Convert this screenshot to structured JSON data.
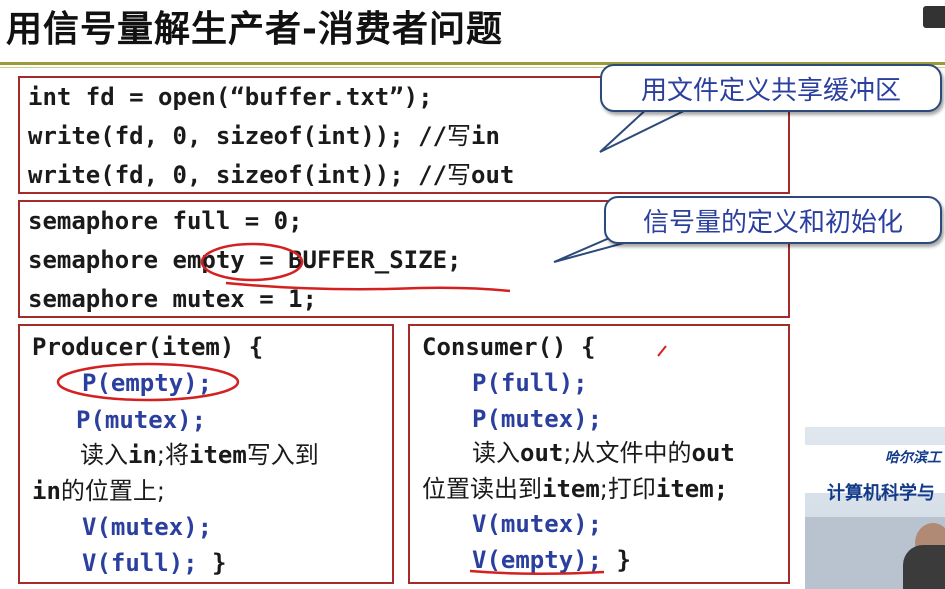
{
  "title": "用信号量解生产者-消费者问题",
  "buffer_block": {
    "lines": [
      "int fd = open(“buffer.txt”);",
      "write(fd, 0, sizeof(int)); //",
      "write(fd, 0, sizeof(int)); //"
    ],
    "line2_cn": "写",
    "line2_tail": "in",
    "line3_cn": "写",
    "line3_tail": "out",
    "callout": "用文件定义共享缓冲区"
  },
  "semaphore_block": {
    "lines": [
      "semaphore full = 0;",
      "semaphore empty = BUFFER_SIZE;",
      "semaphore mutex = 1;"
    ],
    "callout": "信号量的定义和初始化"
  },
  "producer": {
    "header": "Producer(item) {",
    "p_empty": "P(empty);",
    "p_mutex": "P(mutex);",
    "read_in_cn1": "读入",
    "read_in_kw1": "in",
    "read_in_cn2": ";将",
    "read_in_kw2": "item",
    "read_in_cn3": "写入到",
    "wrap_kw": "in",
    "wrap_cn": "的位置上;",
    "v_mutex": "V(mutex);",
    "v_full": "V(full);",
    "close": " }"
  },
  "consumer": {
    "header": "Consumer() {",
    "p_full": "P(full);",
    "p_mutex": "P(mutex);",
    "read_cn1": "读入",
    "read_kw1": "out",
    "read_cn2": ";从文件中的",
    "read_kw2": "out",
    "wrap_cn1": "位置读出到",
    "wrap_kw1": "item",
    "wrap_cn2": ";打印",
    "wrap_kw2": "item",
    "wrap_end": ";",
    "v_mutex": "V(mutex);",
    "v_empty": "V(empty);",
    "close": " }"
  },
  "video": {
    "school": "哈尔滨工",
    "dept": "计算机科学与"
  },
  "colors": {
    "box_border": "#a52a2a",
    "code_blue": "#2b3f9e",
    "annotation_red": "#d42020",
    "callout_border": "#2c4a7a"
  }
}
